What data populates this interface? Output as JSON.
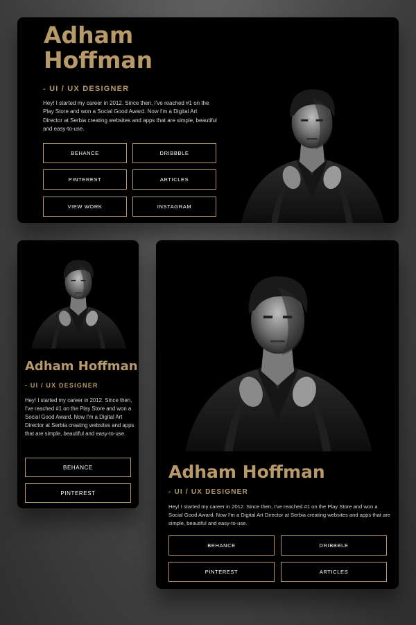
{
  "profile": {
    "name_line1": "Adham",
    "name_line2": "Hoffman",
    "name_full": "Adham Hoffman",
    "role": "- UI / UX DESIGNER",
    "bio": "Hey! I started my career in 2012. Since then, I've reached #1 on the Play Store and won a Social Good Award. Now I'm a Digital Art Director at Serbia creating websites and apps that are simple, beautiful and easy-to-use."
  },
  "buttons": {
    "behance": "BEHANCE",
    "dribbble": "DRIBBBLE",
    "pinterest": "PINTEREST",
    "articles": "ARTICLES",
    "view_work": "VIEW WORK",
    "instagram": "INSTAGRAM"
  },
  "icons": {
    "portrait": "man-portrait-photo"
  },
  "colors": {
    "accent": "#b89a6a",
    "card_bg": "#000000",
    "text": "#d6d6d6"
  }
}
